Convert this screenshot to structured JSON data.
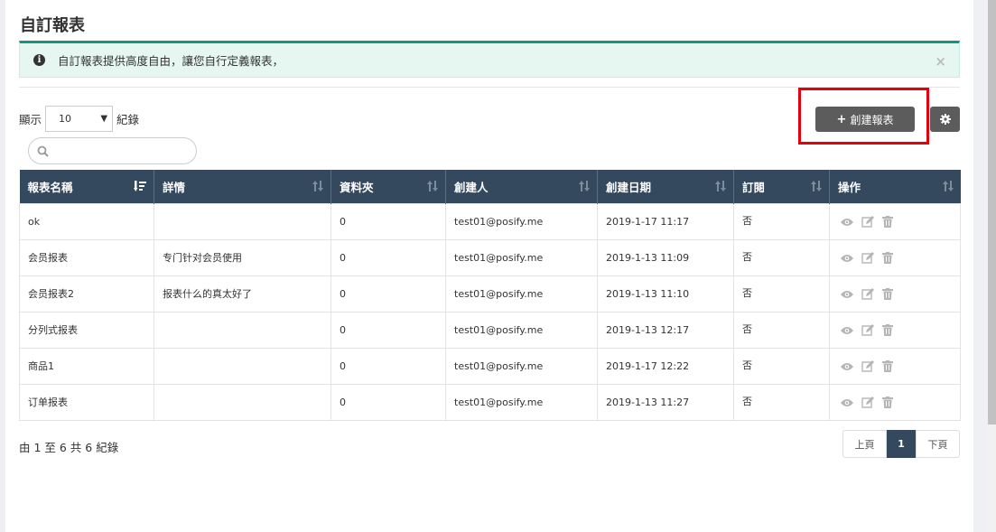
{
  "page": {
    "title": "自訂報表"
  },
  "alert": {
    "text": "自訂報表提供高度自由，讓您自行定義報表，",
    "close": "×"
  },
  "length": {
    "prefix": "顯示",
    "value": "10",
    "suffix": "紀錄"
  },
  "search": {
    "placeholder": ""
  },
  "toolbar": {
    "create_label": "創建報表"
  },
  "table": {
    "headers": [
      "報表名稱",
      "詳情",
      "資料夾",
      "創建人",
      "創建日期",
      "訂閱",
      "操作"
    ],
    "rows": [
      {
        "name": "ok",
        "detail": "",
        "folder": "0",
        "creator": "test01@posify.me",
        "date": "2019-1-17 11:17",
        "sub": "否"
      },
      {
        "name": "会员报表",
        "detail": "专门针对会员使用",
        "folder": "0",
        "creator": "test01@posify.me",
        "date": "2019-1-13 11:09",
        "sub": "否"
      },
      {
        "name": "会员报表2",
        "detail": "报表什么的真太好了",
        "folder": "0",
        "creator": "test01@posify.me",
        "date": "2019-1-13 11:10",
        "sub": "否"
      },
      {
        "name": "分列式报表",
        "detail": "",
        "folder": "0",
        "creator": "test01@posify.me",
        "date": "2019-1-13 12:17",
        "sub": "否"
      },
      {
        "name": "商品1",
        "detail": "",
        "folder": "0",
        "creator": "test01@posify.me",
        "date": "2019-1-17 12:22",
        "sub": "否"
      },
      {
        "name": "订单报表",
        "detail": "",
        "folder": "0",
        "creator": "test01@posify.me",
        "date": "2019-1-13 11:27",
        "sub": "否"
      }
    ],
    "row_actions": [
      "eye-icon",
      "edit-icon",
      "trash-icon"
    ]
  },
  "footer": {
    "info": "由 1 至 6 共 6 紀錄",
    "prev": "上頁",
    "current": "1",
    "next": "下頁"
  },
  "colors": {
    "header_bg": "#34495e",
    "alert_border": "#13967d",
    "alert_bg": "#e6f7f1",
    "button_bg": "#5c5c5c",
    "highlight": "#e6000b"
  }
}
